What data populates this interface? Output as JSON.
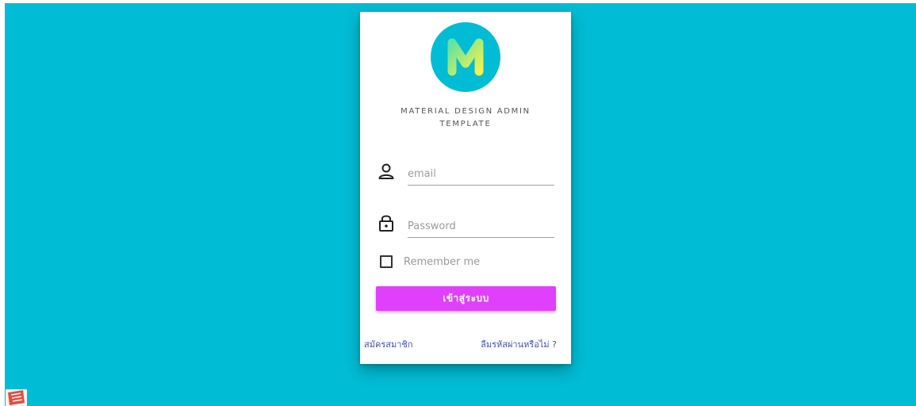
{
  "card": {
    "title": "MATERIAL DESIGN ADMIN TEMPLATE",
    "logo_letter": "M"
  },
  "form": {
    "email_placeholder": "email",
    "email_value": "",
    "email_icon": "user-icon",
    "password_placeholder": "Password",
    "password_value": "",
    "password_icon": "lock-icon",
    "remember_label": "Remember me",
    "remember_checked": false,
    "submit_label": "เข้าสู่ระบบ"
  },
  "links": {
    "register_label": "สมัครสมาชิก",
    "forgot_label": "ลืมรหัสผ่านหรือไม่ ?"
  },
  "colors": {
    "background": "#00bcd4",
    "button": "#e040fb",
    "link": "#3f51b5",
    "logo_circle": "#00bcd4"
  }
}
